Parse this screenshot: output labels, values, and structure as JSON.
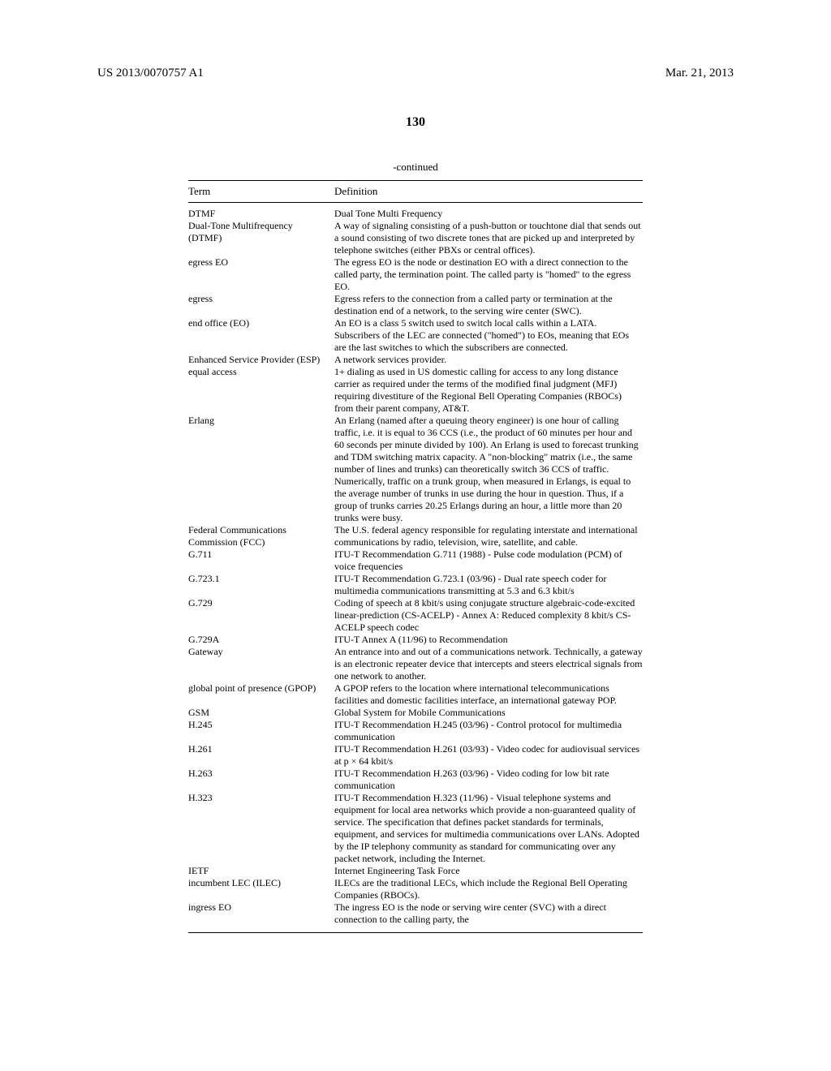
{
  "header": {
    "publication": "US 2013/0070757 A1",
    "date": "Mar. 21, 2013"
  },
  "page_number": "130",
  "continued_label": "-continued",
  "table_header": {
    "term": "Term",
    "definition": "Definition"
  },
  "entries": [
    {
      "term": "DTMF",
      "definition": "Dual Tone Multi Frequency"
    },
    {
      "term": "Dual-Tone Multifrequency (DTMF)",
      "definition": "A way of signaling consisting of a push-button or touchtone dial that sends out a sound consisting of two discrete tones that are picked up and interpreted by telephone switches (either PBXs or central offices)."
    },
    {
      "term": "egress EO",
      "definition": "The egress EO is the node or destination EO with a direct connection to the called party, the termination point. The called party is \"homed\" to the egress EO."
    },
    {
      "term": "egress",
      "definition": "Egress refers to the connection from a called party or termination at the destination end of a network, to the serving wire center (SWC)."
    },
    {
      "term": "end office (EO)",
      "definition": "An EO is a class 5 switch used to switch local calls within a LATA. Subscribers of the LEC are connected (\"homed\") to EOs, meaning that EOs are the last switches to which the subscribers are connected."
    },
    {
      "term": "Enhanced Service Provider (ESP)",
      "definition": "A network services provider."
    },
    {
      "term": "equal access",
      "definition": "1+ dialing as used in US domestic calling for access to any long distance carrier as required under the terms of the modified final judgment (MFJ) requiring divestiture of the Regional Bell Operating Companies (RBOCs) from their parent company, AT&T."
    },
    {
      "term": "Erlang",
      "definition": "An Erlang (named after a queuing theory engineer) is one hour of calling traffic, i.e. it is equal to 36 CCS (i.e., the product of 60 minutes per hour and 60 seconds per minute divided by 100). An Erlang is used to forecast trunking and TDM switching matrix capacity. A \"non-blocking\" matrix (i.e., the same number of lines and trunks) can theoretically switch 36 CCS of traffic. Numerically, traffic on a trunk group, when measured in Erlangs, is equal to the average number of trunks in use during the hour in question. Thus, if a group of trunks carries 20.25 Erlangs during an hour, a little more than 20 trunks were busy."
    },
    {
      "term": "Federal Communications Commission (FCC)",
      "definition": "The U.S. federal agency responsible for regulating interstate and international communications by radio, television, wire, satellite, and cable."
    },
    {
      "term": "G.711",
      "definition": "ITU-T Recommendation G.711 (1988) - Pulse code modulation (PCM) of voice frequencies"
    },
    {
      "term": "G.723.1",
      "definition": "ITU-T Recommendation G.723.1 (03/96) - Dual rate speech coder for multimedia communications transmitting at 5.3 and 6.3 kbit/s"
    },
    {
      "term": "G.729",
      "definition": "Coding of speech at 8 kbit/s using conjugate structure algebraic-code-excited linear-prediction (CS-ACELP) - Annex A: Reduced complexity 8 kbit/s CS-ACELP speech codec"
    },
    {
      "term": "G.729A",
      "definition": "ITU-T Annex A (11/96) to Recommendation"
    },
    {
      "term": "Gateway",
      "definition": "An entrance into and out of a communications network. Technically, a gateway is an electronic repeater device that intercepts and steers electrical signals from one network to another."
    },
    {
      "term": "global point of presence (GPOP)",
      "definition": "A GPOP refers to the location where international telecommunications facilities and domestic facilities interface, an international gateway POP."
    },
    {
      "term": "GSM",
      "definition": "Global System for Mobile Communications"
    },
    {
      "term": "H.245",
      "definition": "ITU-T Recommendation H.245 (03/96) - Control protocol for multimedia communication"
    },
    {
      "term": "H.261",
      "definition": "ITU-T Recommendation H.261 (03/93) - Video codec for audiovisual services at p × 64 kbit/s"
    },
    {
      "term": "H.263",
      "definition": "ITU-T Recommendation H.263 (03/96) - Video coding for low bit rate communication"
    },
    {
      "term": "H.323",
      "definition": "ITU-T Recommendation H.323 (11/96) - Visual telephone systems and equipment for local area networks which provide a non-guaranteed quality of service. The specification that defines packet standards for terminals, equipment, and services for multimedia communications over LANs. Adopted by the IP telephony community as standard for communicating over any packet network, including the Internet."
    },
    {
      "term": "IETF",
      "definition": "Internet Engineering Task Force"
    },
    {
      "term": "incumbent LEC (ILEC)",
      "definition": "ILECs are the traditional LECs, which include the Regional Bell Operating Companies (RBOCs)."
    },
    {
      "term": "ingress EO",
      "definition": "The ingress EO is the node or serving wire center (SVC) with a direct connection to the calling party, the"
    }
  ]
}
